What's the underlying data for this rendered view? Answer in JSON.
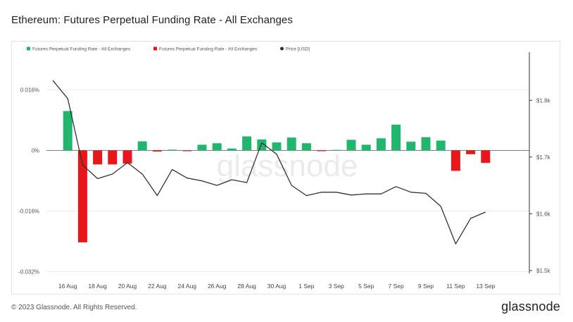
{
  "header": {
    "title": "Ethereum: Futures Perpetual Funding Rate - All Exchanges"
  },
  "footer": {
    "copyright": "© 2023 Glassnode. All Rights Reserved.",
    "brand": "glassnode"
  },
  "watermark": "glassnode",
  "colors": {
    "positive": "#21b66e",
    "negative": "#e8171b",
    "price": "#333333",
    "grid": "#ececec",
    "axis": "#333333"
  },
  "chart_data": {
    "type": "bar",
    "title": "Ethereum: Futures Perpetual Funding Rate - All Exchanges",
    "legend": [
      {
        "label": "Futures Perpetual Funding Rate - All Exchanges",
        "color": "#21b66e",
        "marker": "square"
      },
      {
        "label": "Futures Perpetual Funding Rate - All Exchanges",
        "color": "#e8171b",
        "marker": "square"
      },
      {
        "label": "Price [USD]",
        "color": "#333333",
        "marker": "circle"
      }
    ],
    "legend_position": "top-left",
    "y_left": {
      "ticks": [
        "0.016%",
        "0%",
        "-0.016%",
        "-0.032%"
      ],
      "tick_values": [
        0.016,
        0,
        -0.016,
        -0.032
      ],
      "range": [
        -0.0325,
        0.0215
      ]
    },
    "y_right": {
      "ticks": [
        "$1.8k",
        "$1.7k",
        "$1.6k",
        "$1.5k"
      ],
      "tick_values": [
        1800,
        1700,
        1600,
        1500
      ],
      "range": [
        1495,
        1855
      ]
    },
    "x_tick_labels": [
      "16 Aug",
      "18 Aug",
      "20 Aug",
      "22 Aug",
      "24 Aug",
      "26 Aug",
      "28 Aug",
      "30 Aug",
      "1 Sep",
      "3 Sep",
      "5 Sep",
      "7 Sep",
      "9 Sep",
      "11 Sep",
      "13 Sep"
    ],
    "grid": true,
    "funding_rate_series": {
      "name": "Futures Perpetual Funding Rate - All Exchanges",
      "x": [
        "2023-08-16",
        "2023-08-17",
        "2023-08-18",
        "2023-08-19",
        "2023-08-20",
        "2023-08-21",
        "2023-08-22",
        "2023-08-23",
        "2023-08-24",
        "2023-08-25",
        "2023-08-26",
        "2023-08-27",
        "2023-08-28",
        "2023-08-29",
        "2023-08-30",
        "2023-08-31",
        "2023-09-01",
        "2023-09-02",
        "2023-09-03",
        "2023-09-04",
        "2023-09-05",
        "2023-09-06",
        "2023-09-07",
        "2023-09-08",
        "2023-09-09",
        "2023-09-10",
        "2023-09-11",
        "2023-09-12",
        "2023-09-13"
      ],
      "values": [
        0.0104,
        -0.0243,
        -0.0037,
        -0.0037,
        -0.0035,
        0.0024,
        -0.0003,
        0.0002,
        -0.0002,
        0.0015,
        0.0019,
        0.0005,
        0.0037,
        0.0029,
        0.0021,
        0.0034,
        0.0019,
        -0.0002,
        0.0001,
        0.0028,
        0.0015,
        0.0032,
        0.0068,
        0.0023,
        0.0035,
        0.0026,
        -0.0054,
        -0.001,
        -0.0033
      ]
    },
    "price_series": {
      "name": "Price [USD]",
      "x": [
        "2023-08-15",
        "2023-08-16",
        "2023-08-17",
        "2023-08-18",
        "2023-08-19",
        "2023-08-20",
        "2023-08-21",
        "2023-08-22",
        "2023-08-23",
        "2023-08-24",
        "2023-08-25",
        "2023-08-26",
        "2023-08-27",
        "2023-08-28",
        "2023-08-29",
        "2023-08-30",
        "2023-08-31",
        "2023-09-01",
        "2023-09-02",
        "2023-09-03",
        "2023-09-04",
        "2023-09-05",
        "2023-09-06",
        "2023-09-07",
        "2023-09-08",
        "2023-09-09",
        "2023-09-10",
        "2023-09-11",
        "2023-09-12",
        "2023-09-13"
      ],
      "values": [
        1835,
        1803,
        1686,
        1662,
        1670,
        1690,
        1670,
        1632,
        1678,
        1663,
        1658,
        1650,
        1660,
        1655,
        1725,
        1705,
        1650,
        1632,
        1638,
        1638,
        1633,
        1635,
        1635,
        1648,
        1638,
        1636,
        1613,
        1547,
        1592,
        1603
      ]
    }
  }
}
